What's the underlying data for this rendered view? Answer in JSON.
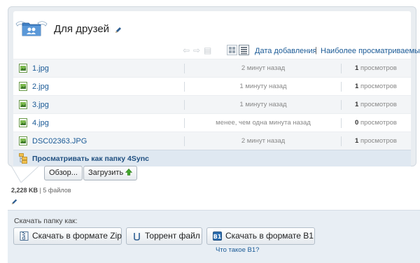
{
  "folder": {
    "title": "Для друзей"
  },
  "toolbar": {
    "sort_date": "Дата добавления",
    "sort_separator": "|",
    "sort_views": "Наиболее просматриваемые"
  },
  "files": [
    {
      "name": "1.jpg",
      "time": "2 минут назад",
      "views_count": "1",
      "views_label": "просмотров"
    },
    {
      "name": "2.jpg",
      "time": "1 минуту назад",
      "views_count": "1",
      "views_label": "просмотров"
    },
    {
      "name": "3.jpg",
      "time": "1 минуту назад",
      "views_count": "1",
      "views_label": "просмотров"
    },
    {
      "name": "4.jpg",
      "time": "менее, чем одна минута назад",
      "views_count": "0",
      "views_label": "просмотров"
    },
    {
      "name": "DSC02363.JPG",
      "time": "2 минут назад",
      "views_count": "1",
      "views_label": "просмотров"
    }
  ],
  "browse": {
    "label": "Просматривать как папку 4Sync"
  },
  "upload": {
    "browse_label": "Обзор...",
    "upload_label": "Загрузить"
  },
  "summary": {
    "size": "2,228 KB",
    "separator": "|",
    "count": "5 файлов"
  },
  "download": {
    "label": "Скачать папку как:",
    "zip_label": "Скачать в формате Zip",
    "torrent_label": "Торрент файл",
    "b1_label": "Скачать в формате B1",
    "b1_help": "Что такое B1?"
  },
  "icons": {
    "folder": "shared-folder-icon",
    "pencil": "pencil-icon",
    "image_file": "image-file-icon",
    "browse": "folder-tree-icon",
    "upload_arrow": "up-arrow-icon",
    "zip": "zip-icon",
    "torrent": "torrent-icon",
    "b1": "b1-icon"
  },
  "colors": {
    "link": "#1a5a96",
    "panel_bg": "#e9edf1",
    "browse_bar_bg": "#dfe8f1",
    "download_bg": "#e8eef4"
  }
}
